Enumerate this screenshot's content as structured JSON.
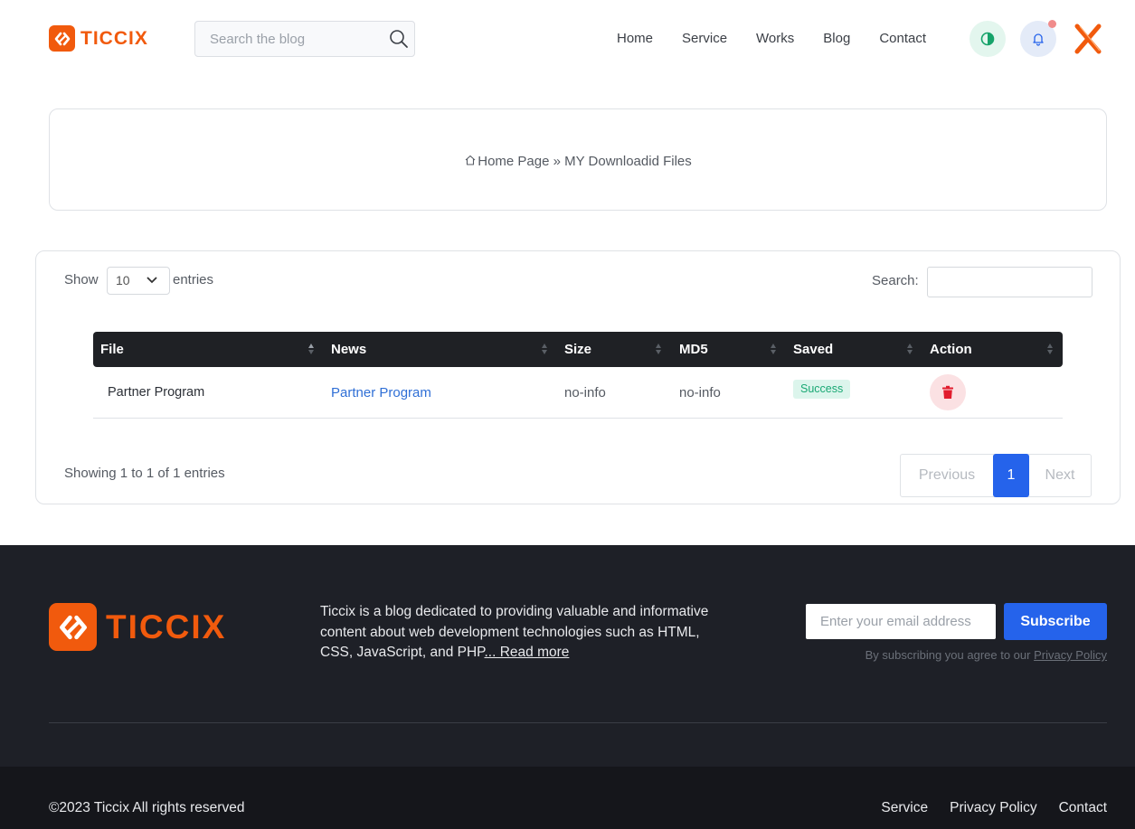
{
  "header": {
    "logo_text": "TICCIX",
    "search_placeholder": "Search the blog",
    "nav": [
      "Home",
      "Service",
      "Works",
      "Blog",
      "Contact"
    ]
  },
  "breadcrumb": {
    "home": "Home Page",
    "separator": " » ",
    "current": "MY Downloadid Files"
  },
  "table": {
    "show_label": "Show",
    "entries_value": "10",
    "entries_label": "entries",
    "search_label": "Search:",
    "columns": [
      "File",
      "News",
      "Size",
      "MD5",
      "Saved",
      "Action"
    ],
    "rows": [
      {
        "file": "Partner Program",
        "news": "Partner Program",
        "size": "no-info",
        "md5": "no-info",
        "saved": "Success"
      }
    ],
    "showing": "Showing 1 to 1 of 1 entries",
    "pagination": {
      "previous": "Previous",
      "current": "1",
      "next": "Next"
    }
  },
  "footer": {
    "logo_text": "TICCIX",
    "about": "Ticcix is a blog dedicated to providing valuable and informative content about web development technologies such as HTML, CSS, JavaScript, and PHP",
    "read_more": "... Read more",
    "email_placeholder": "Enter your email address",
    "subscribe": "Subscribe",
    "agree_text": "By subscribing you agree to our ",
    "privacy_link": "Privacy Policy",
    "copyright": "©2023 Ticcix All rights reserved",
    "links": [
      "Service",
      "Privacy Policy",
      "Contact"
    ]
  },
  "colors": {
    "brand": "#f15a0d",
    "primary": "#2563eb",
    "success": "#1aa874",
    "danger": "#e11d2e",
    "dark": "#1f2125"
  },
  "icons": [
    "search-icon",
    "theme-toggle-icon",
    "bell-icon",
    "x-logo-icon",
    "home-icon",
    "chevron-down-icon",
    "sort-icon",
    "trash-icon"
  ]
}
